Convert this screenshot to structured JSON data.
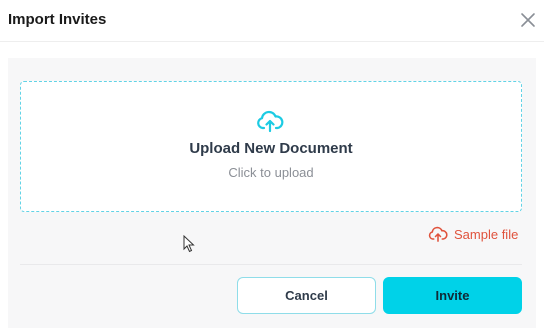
{
  "dialog": {
    "title": "Import Invites",
    "close_icon": "close-icon"
  },
  "upload": {
    "icon": "cloud-upload-icon",
    "title": "Upload New Document",
    "subtitle": "Click to upload"
  },
  "sample": {
    "icon": "cloud-upload-icon",
    "label": "Sample file"
  },
  "actions": {
    "cancel_label": "Cancel",
    "invite_label": "Invite"
  },
  "colors": {
    "accent": "#00d2e8",
    "sample_red": "#e0533d",
    "text_dark": "#2f3b4a"
  }
}
